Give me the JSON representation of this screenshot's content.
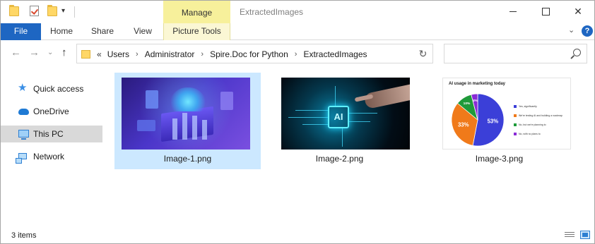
{
  "window": {
    "title": "ExtractedImages",
    "context_tab_label": "Manage"
  },
  "ribbon": {
    "tabs": [
      {
        "label": "File"
      },
      {
        "label": "Home"
      },
      {
        "label": "Share"
      },
      {
        "label": "View"
      },
      {
        "label": "Picture Tools"
      }
    ]
  },
  "address": {
    "overflow": "«",
    "crumbs": [
      "Users",
      "Administrator",
      "Spire.Doc for Python",
      "ExtractedImages"
    ],
    "search_placeholder": ""
  },
  "nav": {
    "items": [
      {
        "label": "Quick access",
        "icon": "star-icon"
      },
      {
        "label": "OneDrive",
        "icon": "cloud-icon"
      },
      {
        "label": "This PC",
        "icon": "computer-icon",
        "selected": true
      },
      {
        "label": "Network",
        "icon": "network-icon"
      }
    ]
  },
  "files": [
    {
      "name": "Image-1.png",
      "selected": true
    },
    {
      "name": "Image-2.png",
      "selected": false
    },
    {
      "name": "Image-3.png",
      "selected": false
    }
  ],
  "image2": {
    "chip_text": "AI"
  },
  "image3": {
    "title": "AI usage in marketing today",
    "slices": [
      {
        "label": "53%",
        "value": 53,
        "color": "#3b3fd8"
      },
      {
        "label": "33%",
        "value": 33,
        "color": "#f07a1a"
      },
      {
        "label": "10%",
        "value": 10,
        "color": "#1f9a3a"
      },
      {
        "label": "4%",
        "value": 4,
        "color": "#8a2bd6"
      }
    ],
    "legend": [
      "Yes, significantly",
      "We're testing AI and building a roadmap",
      "No, but we're planning to",
      "No, with no plans to"
    ]
  },
  "status": {
    "item_count": "3 items"
  }
}
